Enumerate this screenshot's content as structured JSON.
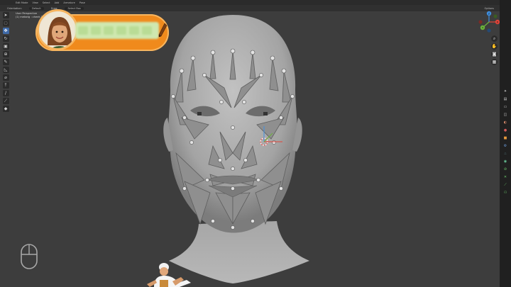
{
  "app": {
    "header_menus": [
      "Edit Mode",
      "View",
      "Select",
      "Add",
      "Armature",
      "Pose"
    ],
    "tool_header": {
      "orientation_label": "Orientation:",
      "orientation_value": "Default",
      "drag_label": "Drag:",
      "drag_value": "Select Box",
      "options_label": "Options"
    },
    "viewport": {
      "perspective_label": "User Perspective",
      "object_label": "(1) metarig : cheek.T.L"
    },
    "toolbar_icons": [
      "cursor-icon",
      "select-icon",
      "move-icon",
      "rotate-icon",
      "scale-icon",
      "transform-icon",
      "annotate-icon",
      "measure-icon",
      "bone-roll-icon",
      "extrude-icon",
      "knife-icon",
      "bone-size-icon",
      "envelope-icon"
    ],
    "properties_tabs": [
      "tool-tab-icon",
      "render-tab-icon",
      "output-tab-icon",
      "view-layer-tab-icon",
      "scene-tab-icon",
      "world-tab-icon",
      "object-tab-icon",
      "modifier-tab-icon",
      "particles-tab-icon",
      "physics-tab-icon",
      "constraints-tab-icon",
      "data-tab-icon",
      "bone-tab-icon",
      "bone-constraint-tab-icon"
    ],
    "nav_gizmo_axes": [
      "X",
      "Y",
      "Z"
    ],
    "colors": {
      "viewport_bg": "#3d3d3d",
      "accent_blue": "#3f6aa8",
      "banner_orange": "#f08a1c",
      "bone_color": "#9a9a9a",
      "head_mesh": "#b0b0b0"
    }
  }
}
